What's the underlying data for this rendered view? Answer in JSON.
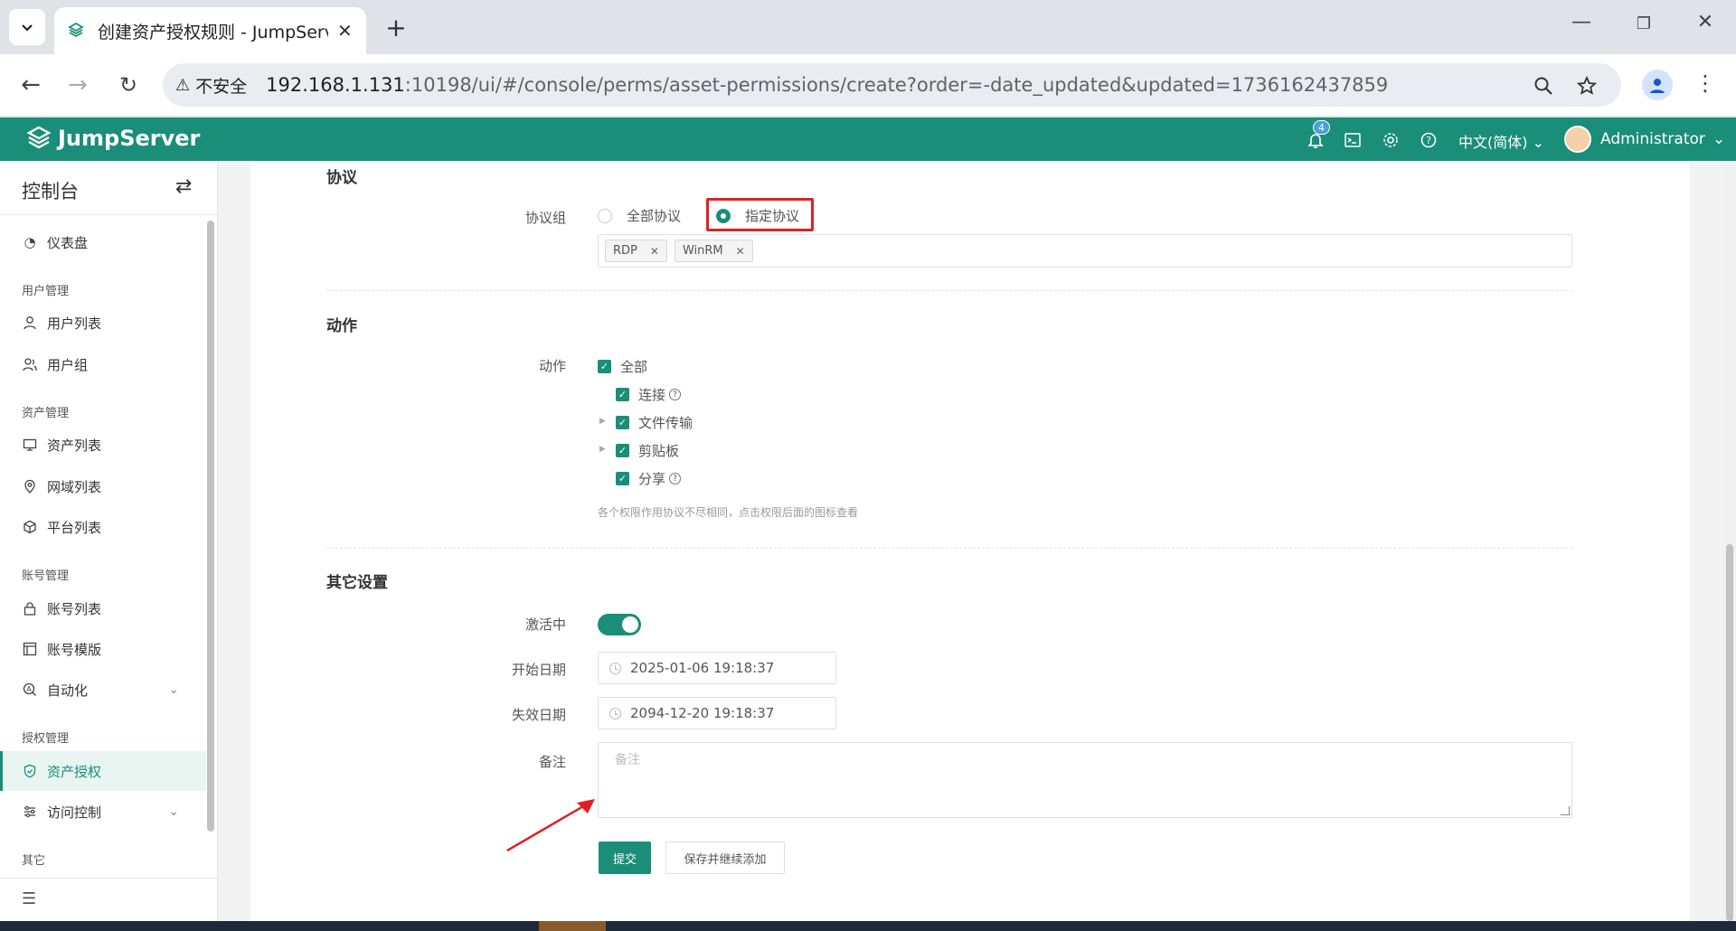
{
  "browser": {
    "tab_title": "创建资产授权规则 - JumpServer",
    "security_label": "不安全",
    "url_host": "192.168.1.131",
    "url_path": ":10198/ui/#/console/perms/asset-permissions/create?order=-date_updated&updated=1736162437859"
  },
  "header": {
    "brand": "JumpServer",
    "notification_count": "4",
    "language": "中文(简体)",
    "user": "Administrator",
    "brand_color": "#1a8e78"
  },
  "sidebar": {
    "title": "控制台",
    "items": {
      "dashboard": "仪表盘",
      "group_users": "用户管理",
      "user_list": "用户列表",
      "user_group": "用户组",
      "group_assets": "资产管理",
      "asset_list": "资产列表",
      "zone_list": "网域列表",
      "platform_list": "平台列表",
      "group_accounts": "账号管理",
      "account_list": "账号列表",
      "account_template": "账号模版",
      "automation": "自动化",
      "group_perms": "授权管理",
      "asset_perms": "资产授权",
      "access_control": "访问控制",
      "group_other": "其它"
    }
  },
  "form": {
    "protocol_section": "协议",
    "protocol_group_label": "协议组",
    "protocol_all": "全部协议",
    "protocol_specified": "指定协议",
    "protocols": [
      "RDP",
      "WinRM"
    ],
    "action_section": "动作",
    "action_label": "动作",
    "actions": {
      "all": "全部",
      "connect": "连接",
      "transfer": "文件传输",
      "clipboard": "剪贴板",
      "share": "分享"
    },
    "action_hint": "各个权限作用协议不尽相同，点击权限后面的图标查看",
    "other_section": "其它设置",
    "active_label": "激活中",
    "start_label": "开始日期",
    "start_value": "2025-01-06 19:18:37",
    "end_label": "失效日期",
    "end_value": "2094-12-20 19:18:37",
    "comment_label": "备注",
    "comment_placeholder": "备注",
    "submit": "提交",
    "save_continue": "保存并继续添加"
  }
}
